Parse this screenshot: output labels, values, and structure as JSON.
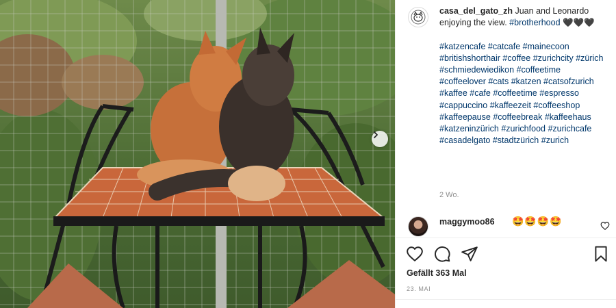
{
  "post": {
    "username": "casa_del_gato_zh",
    "caption_lead": "Juan and Leonardo enjoying the view.",
    "caption_tag1": "#brotherhood",
    "caption_hearts": "🖤🖤🖤",
    "hashtags": [
      "#katzencafe",
      "#catcafe",
      "#mainecoon",
      "#britishshorthair",
      "#coffee",
      "#zurichcity",
      "#zürich",
      "#schmiedewiedikon",
      "#coffeetime",
      "#coffeelover",
      "#cats",
      "#katzen",
      "#catsofzurich",
      "#kaffee",
      "#cafe",
      "#coffeetime",
      "#espresso",
      "#cappuccino",
      "#kaffeezeit",
      "#coffeeshop",
      "#kaffeepause",
      "#coffeebreak",
      "#kaffeehaus",
      "#katzeninzürich",
      "#zurichfood",
      "#zurichcafe",
      "#casadelgato",
      "#stadtzürich",
      "#zurich"
    ],
    "time_ago": "2 Wo."
  },
  "comment": {
    "username": "maggymoo86",
    "text": "🤩🤩🤩🤩"
  },
  "stats": {
    "likes_text": "Gefällt 363 Mal",
    "date": "23. MAI"
  },
  "icons": {
    "next": "chevron-right-icon",
    "like": "heart-outline-icon",
    "comment": "comment-bubble-icon",
    "share": "paper-plane-icon",
    "save": "bookmark-icon"
  },
  "colors": {
    "hashtag": "#00376b",
    "text": "#262626",
    "muted": "#8e8e8e"
  }
}
